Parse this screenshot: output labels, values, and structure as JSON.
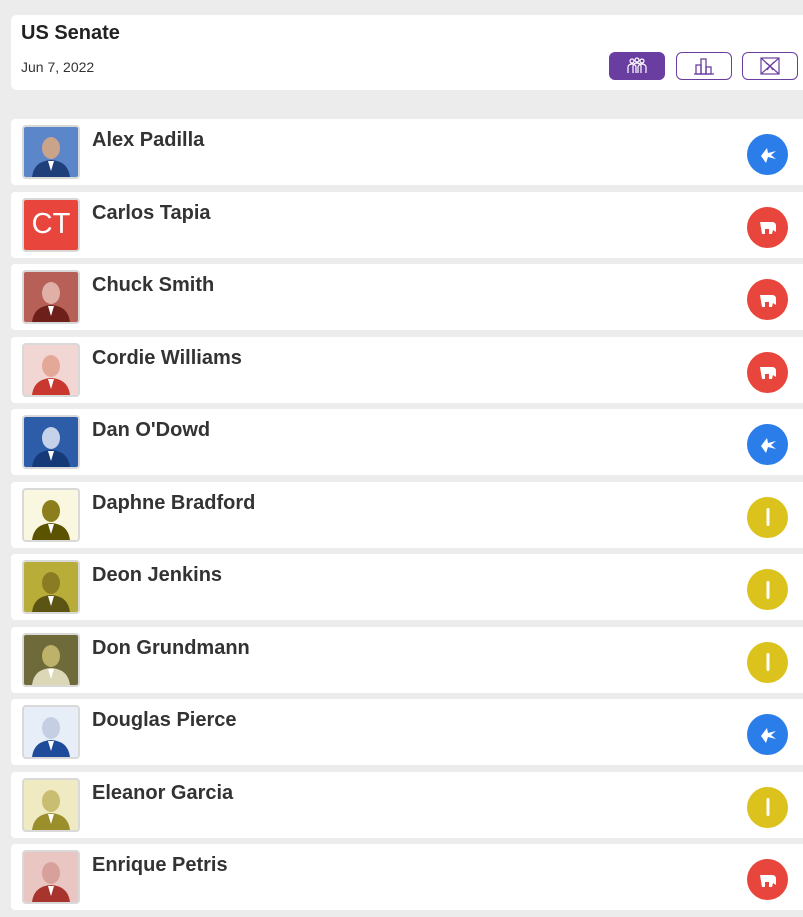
{
  "header": {
    "title": "US Senate",
    "date": "Jun 7, 2022",
    "views": [
      {
        "icon": "candidates-icon",
        "active": true
      },
      {
        "icon": "bar-chart-icon",
        "active": false
      },
      {
        "icon": "map-icon",
        "active": false
      }
    ]
  },
  "colors": {
    "accent": "#6a3ea1",
    "democrat": "#2b7de9",
    "republican": "#e8463c",
    "independent": "#dcc21d"
  },
  "candidates": [
    {
      "name": "Alex Padilla",
      "party": "democrat",
      "party_icon": "donkey-icon",
      "avatar": "photo"
    },
    {
      "name": "Carlos Tapia",
      "party": "republican",
      "party_icon": "elephant-icon",
      "avatar": "initials",
      "initials": "CT"
    },
    {
      "name": "Chuck Smith",
      "party": "republican",
      "party_icon": "elephant-icon",
      "avatar": "photo"
    },
    {
      "name": "Cordie Williams",
      "party": "republican",
      "party_icon": "elephant-icon",
      "avatar": "photo"
    },
    {
      "name": "Dan O'Dowd",
      "party": "democrat",
      "party_icon": "donkey-icon",
      "avatar": "photo"
    },
    {
      "name": "Daphne Bradford",
      "party": "independent",
      "party_icon": "independent-icon",
      "avatar": "photo"
    },
    {
      "name": "Deon Jenkins",
      "party": "independent",
      "party_icon": "independent-icon",
      "avatar": "photo"
    },
    {
      "name": "Don Grundmann",
      "party": "independent",
      "party_icon": "independent-icon",
      "avatar": "photo"
    },
    {
      "name": "Douglas Pierce",
      "party": "democrat",
      "party_icon": "donkey-icon",
      "avatar": "photo"
    },
    {
      "name": "Eleanor Garcia",
      "party": "independent",
      "party_icon": "independent-icon",
      "avatar": "photo"
    },
    {
      "name": "Enrique Petris",
      "party": "republican",
      "party_icon": "elephant-icon",
      "avatar": "photo"
    }
  ]
}
